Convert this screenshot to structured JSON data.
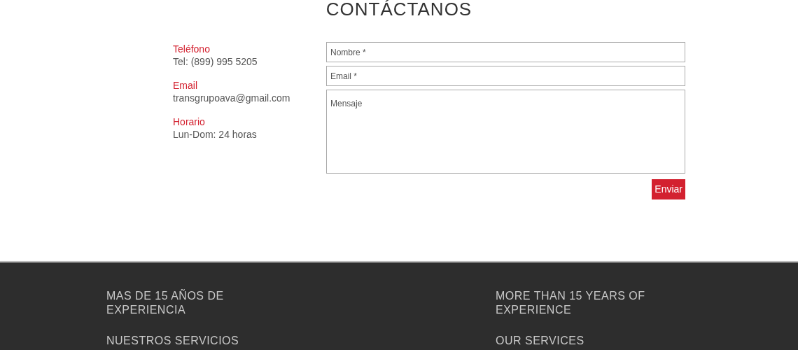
{
  "title": "CONTÁCTANOS",
  "contact_info": [
    {
      "label": "Teléfono",
      "value": "Tel: (899) 995 5205"
    },
    {
      "label": "Email",
      "value": "transgrupoava@gmail.com"
    },
    {
      "label": "Horario",
      "value": "Lun-Dom: 24 horas"
    }
  ],
  "form": {
    "fields": [
      {
        "kind": "input",
        "placeholder": "Nombre *"
      },
      {
        "kind": "input",
        "placeholder": "Email *"
      },
      {
        "kind": "textarea",
        "placeholder": "Mensaje"
      }
    ],
    "submit": "Enviar"
  },
  "footer": {
    "columns": [
      {
        "headings": [
          "MAS DE 15 AÑOS DE EXPERIENCIA",
          "NUESTROS SERVICIOS"
        ]
      },
      {
        "headings": [
          "MORE THAN 15 YEARS OF EXPERIENCE",
          "OUR SERVICES"
        ]
      }
    ]
  }
}
